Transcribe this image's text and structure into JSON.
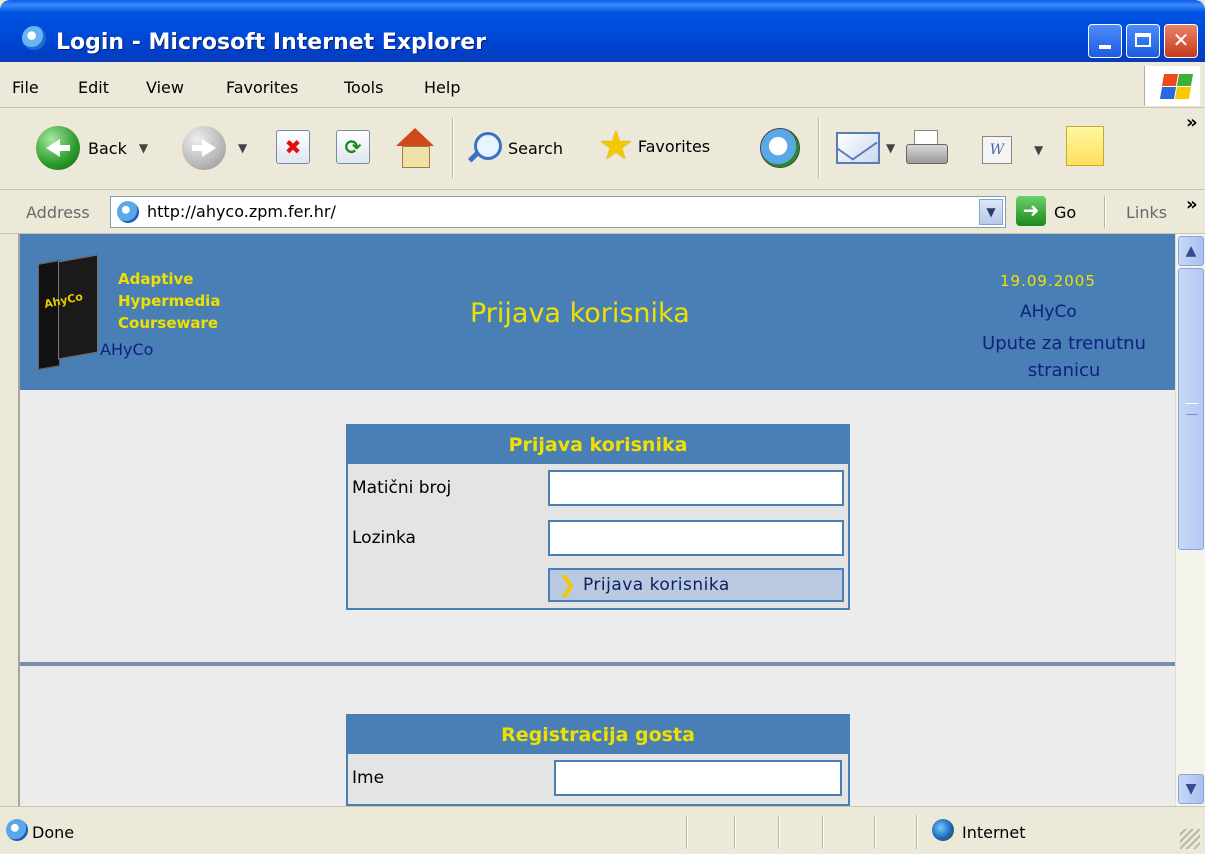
{
  "window": {
    "title": "Login - Microsoft Internet Explorer"
  },
  "menu": [
    "File",
    "Edit",
    "View",
    "Favorites",
    "Tools",
    "Help"
  ],
  "toolbar": {
    "back_label": "Back",
    "search_label": "Search",
    "favorites_label": "Favorites",
    "more_chevron": "»"
  },
  "address": {
    "label": "Address",
    "url": "http://ahyco.zpm.fer.hr/",
    "go_label": "Go",
    "links_label": "Links",
    "links_chevron": "»"
  },
  "header": {
    "logo_lines": [
      "Adaptive",
      "Hypermedia",
      "Courseware"
    ],
    "book_label": "AhyCo",
    "logo_name": "AHyCo",
    "title": "Prijava korisnika",
    "date": "19.09.2005",
    "app_name": "AHyCo",
    "help_link": "Upute za trenutnu stranicu"
  },
  "login": {
    "title": "Prijava korisnika",
    "fields": [
      {
        "label": "Matični broj",
        "value": ""
      },
      {
        "label": "Lozinka",
        "value": ""
      }
    ],
    "submit_label": "Prijava korisnika"
  },
  "guest": {
    "title": "Registracija gosta",
    "fields": [
      {
        "label": "Ime",
        "value": ""
      }
    ]
  },
  "status": {
    "text": "Done",
    "zone": "Internet"
  },
  "colors": {
    "header_bg": "#4a7fb5",
    "accent_yellow": "#f0e000",
    "link_blue": "#102080"
  }
}
